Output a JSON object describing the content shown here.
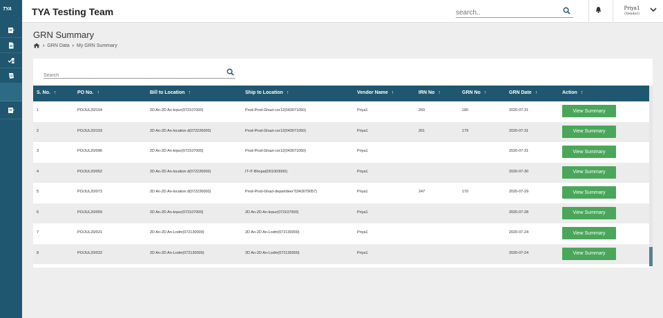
{
  "sidebar": {
    "logo": "TYA",
    "items": [
      {
        "icon": "edit-document-icon"
      },
      {
        "icon": "document-icon"
      },
      {
        "icon": "receipt-check-icon"
      },
      {
        "icon": "notes-icon"
      },
      {
        "icon": "blank-active-item"
      },
      {
        "icon": "edit-list-icon"
      }
    ]
  },
  "header": {
    "title": "TYA Testing Team",
    "search_placeholder": "search..",
    "user_name": "Priya1",
    "user_sub": "(Vendor)"
  },
  "page": {
    "title": "GRN Summary",
    "breadcrumb": [
      "GRN Data",
      "My GRN Summary"
    ]
  },
  "card": {
    "search_placeholder": "Search"
  },
  "table": {
    "columns": [
      "S. No.",
      "PO No.",
      "Bill to Location",
      "Ship to Location",
      "Vendor Name",
      "IRN No",
      "GRN No",
      "GRN Date",
      "Action"
    ],
    "rows": [
      {
        "sno": "1",
        "po": "PO/JUL20/104",
        "bill": "2D An-2D An-krpur(072107000)",
        "ship": "Prod-Prod-Ghazi-cor12(043071050)",
        "vendor": "Priya1",
        "irn": "260",
        "grn": "180",
        "date": "2020-07-31",
        "action": "View Summary"
      },
      {
        "sno": "2",
        "po": "PO/JUL20/103",
        "bill": "2D An-2D An-location d(072226000)",
        "ship": "Prod-Prod-Ghazi-cor12(043071050)",
        "vendor": "Priya1",
        "irn": "261",
        "grn": "179",
        "date": "2020-07-31",
        "action": "View Summary"
      },
      {
        "sno": "3",
        "po": "PO/JUL20/096",
        "bill": "2D An-2D An-krpur(072107000)",
        "ship": "Prod-Prod-Ghazi-cor12(043071050)",
        "vendor": "Priya1",
        "irn": "",
        "grn": "",
        "date": "2020-07-31",
        "action": "View Summary"
      },
      {
        "sno": "4",
        "po": "PO/JUL20/052",
        "bill": "2D An-2D An-location d(072226000)",
        "ship": "IT-IT-Bhopal(001003000)",
        "vendor": "Priya1",
        "irn": "",
        "grn": "",
        "date": "2020-07-30",
        "action": "View Summary"
      },
      {
        "sno": "5",
        "po": "PO/JUL20/073",
        "bill": "2D An-2D An-location d(072226000)",
        "ship": "Prod-Prod-Ghazi-departdeer?(043079057)",
        "vendor": "Priya1",
        "irn": "247",
        "grn": "170",
        "date": "2020-07-29",
        "action": "View Summary"
      },
      {
        "sno": "6",
        "po": "PO/JUL20/059",
        "bill": "2D An-2D An-krpur(072107000)",
        "ship": "2D An-2D An-krpur(072107000)",
        "vendor": "Priya1",
        "irn": "",
        "grn": "",
        "date": "2020-07-28",
        "action": "View Summary"
      },
      {
        "sno": "7",
        "po": "PO/JUL20/021",
        "bill": "2D An-2D An-Lodm(072130000)",
        "ship": "2D An-2D An-Lodm(072130000)",
        "vendor": "Priya1",
        "irn": "",
        "grn": "",
        "date": "2020-07-24",
        "action": "View Summary"
      },
      {
        "sno": "8",
        "po": "PO/JUL20/022",
        "bill": "2D An-2D An-Lodm(072130000)",
        "ship": "2D An-2D An-Lodm(072130000)",
        "vendor": "Priya1",
        "irn": "",
        "grn": "",
        "date": "2020-07-24",
        "action": "View Summary"
      }
    ]
  },
  "colors": {
    "sidebar": "#1f5770",
    "table_header": "#1f5770",
    "button": "#4aa65a",
    "search_icon": "#1f5770"
  }
}
